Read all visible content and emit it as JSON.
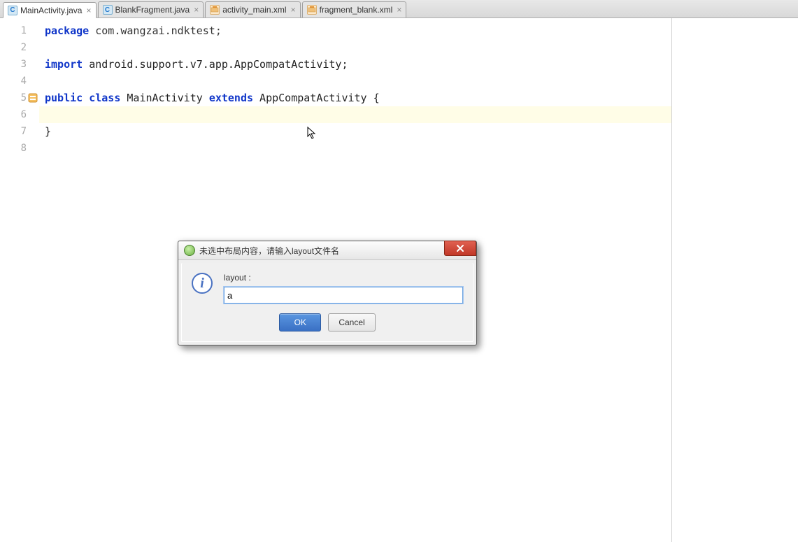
{
  "tabs": [
    {
      "label": "MainActivity.java",
      "icon": "class",
      "active": true
    },
    {
      "label": "BlankFragment.java",
      "icon": "class",
      "active": false
    },
    {
      "label": "activity_main.xml",
      "icon": "xml",
      "active": false
    },
    {
      "label": "fragment_blank.xml",
      "icon": "xml",
      "active": false
    }
  ],
  "line_numbers": [
    "1",
    "2",
    "3",
    "4",
    "5",
    "6",
    "7",
    "8"
  ],
  "code": {
    "l1_kw": "package",
    "l1_rest": " com.wangzai.ndktest;",
    "l2": "",
    "l3_kw": "import",
    "l3_rest": " android.support.v7.app.AppCompatActivity;",
    "l4": "",
    "l5_kw1": "public",
    "l5_kw2": "class",
    "l5_name": " MainActivity ",
    "l5_kw3": "extends",
    "l5_rest": " AppCompatActivity {",
    "l6": "",
    "l7": "}",
    "l8": ""
  },
  "dialog": {
    "title": "未选中布局内容，请输入layout文件名",
    "label": "layout :",
    "input_value": "a",
    "ok": "OK",
    "cancel": "Cancel",
    "icon_letter": "i",
    "class_glyph": "C"
  }
}
